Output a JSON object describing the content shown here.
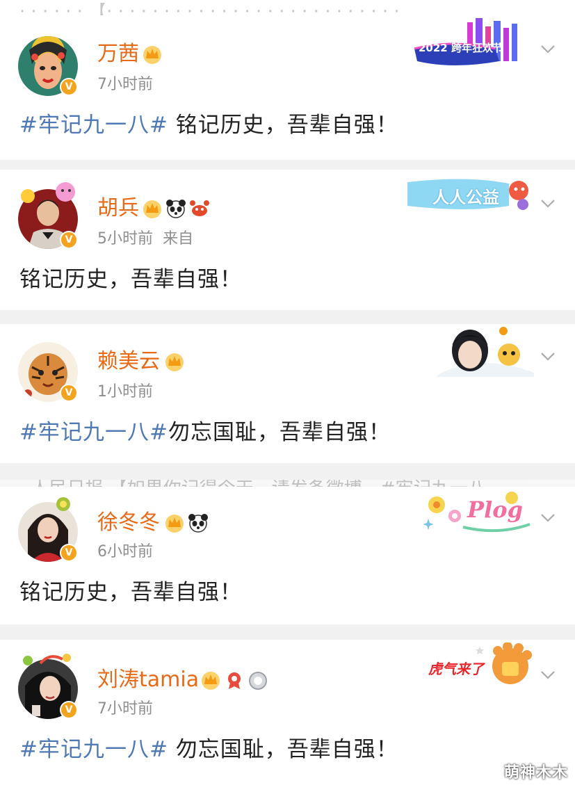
{
  "top_cut_text": "· · · · · · 【· · · · · · · · · · · · · · · · · · · · · · · · · ·",
  "middle_cut_text": "· 人民日报 【如果你记得今天，请发条微博，#牢记九一八",
  "posts": [
    {
      "name": "万茜",
      "time": "7小时前",
      "source_prefix": "",
      "hashtag": "#牢记九一八#",
      "body": " 铭记历史，吾辈自强！",
      "decoration_text": "2022 跨年狂欢节",
      "badges": [
        "crown-icon"
      ]
    },
    {
      "name": "胡兵",
      "time": "5小时前",
      "source_prefix": "来自",
      "hashtag": "",
      "body": "铭记历史，吾辈自强！",
      "decoration_text": "人人公益",
      "badges": [
        "crown-icon",
        "panda-icon",
        "crab-icon"
      ]
    },
    {
      "name": "赖美云",
      "time": "1小时前",
      "source_prefix": "",
      "hashtag": "#牢记九一八#",
      "body": "勿忘国耻，吾辈自强！",
      "decoration_text": "",
      "badges": [
        "crown-icon"
      ]
    },
    {
      "name": "徐冬冬",
      "time": "6小时前",
      "source_prefix": "",
      "hashtag": "",
      "body": "铭记历史，吾辈自强！",
      "decoration_text": "Plog",
      "badges": [
        "crown-icon",
        "panda-icon"
      ]
    },
    {
      "name": "刘涛tamia",
      "time": "7小时前",
      "source_prefix": "",
      "hashtag": "#牢记九一八#",
      "body": " 勿忘国耻，吾辈自强！",
      "decoration_text": "虎气来了",
      "badges": [
        "crown-icon",
        "medal-icon",
        "medal-silver-icon"
      ]
    }
  ],
  "watermark": "萌神木木",
  "colors": {
    "name": "#e96a16",
    "hashtag": "#4e79b4",
    "vip_badge": "#f3a31e",
    "meta": "#8e8e8e"
  }
}
